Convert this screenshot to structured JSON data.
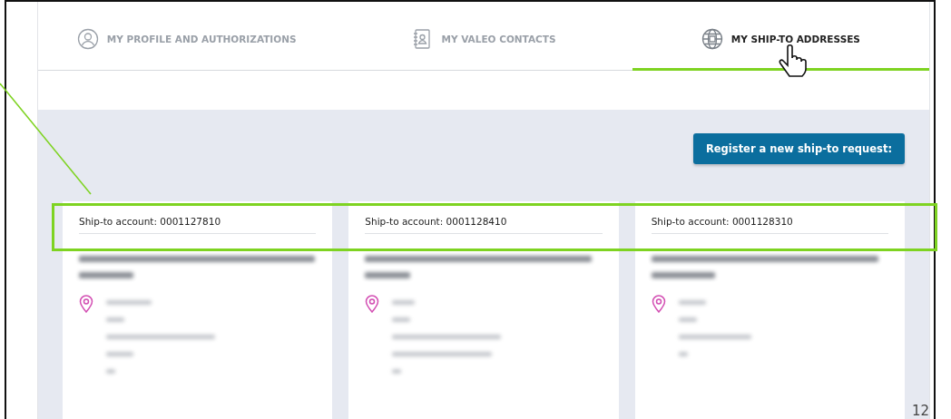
{
  "tabs": [
    {
      "label": "MY PROFILE AND AUTHORIZATIONS",
      "selected": false
    },
    {
      "label": "MY VALEO CONTACTS",
      "selected": false
    },
    {
      "label": "MY SHIP-TO ADDRESSES",
      "selected": true
    }
  ],
  "register_button": "Register a new ship-to request:",
  "cards": [
    {
      "account": "Ship-to account: 0001127810"
    },
    {
      "account": "Ship-to account: 0001128410"
    },
    {
      "account": "Ship-to account: 0001128310"
    }
  ],
  "page_number": "12"
}
